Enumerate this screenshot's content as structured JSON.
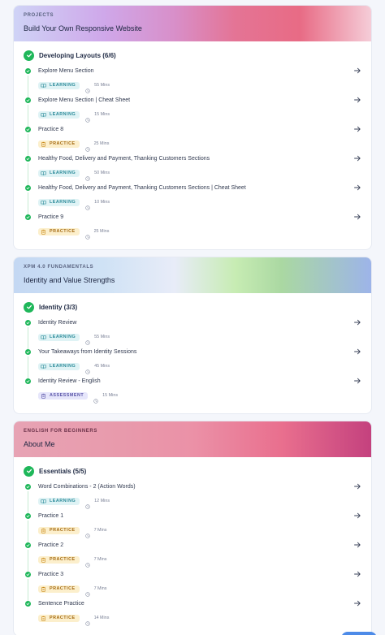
{
  "courses": [
    {
      "tag": "PROJECTS",
      "title": "Build Your Own Responsive Website",
      "module": "Developing Layouts (6/6)",
      "items": [
        {
          "title": "Explore Menu Section",
          "type": "LEARNING",
          "duration": "55 Mins"
        },
        {
          "title": "Explore Menu Section | Cheat Sheet",
          "type": "LEARNING",
          "duration": "15 Mins"
        },
        {
          "title": "Practice 8",
          "type": "PRACTICE",
          "duration": "25 Mins"
        },
        {
          "title": "Healthy Food, Delivery and Payment, Thanking Customers Sections",
          "type": "LEARNING",
          "duration": "50 Mins"
        },
        {
          "title": "Healthy Food, Delivery and Payment, Thanking Customers Sections | Cheat Sheet",
          "type": "LEARNING",
          "duration": "10 Mins"
        },
        {
          "title": "Practice 9",
          "type": "PRACTICE",
          "duration": "25 Mins"
        }
      ]
    },
    {
      "tag": "XPM 4.0 FUNDAMENTALS",
      "title": "Identity and Value Strengths",
      "module": "Identity (3/3)",
      "items": [
        {
          "title": "Identity Review",
          "type": "LEARNING",
          "duration": "55 Mins"
        },
        {
          "title": "Your Takeaways from Identity Sessions",
          "type": "LEARNING",
          "duration": "45 Mins"
        },
        {
          "title": "Identity Review - English",
          "type": "ASSESSMENT",
          "duration": "15 Mins"
        }
      ]
    },
    {
      "tag": "ENGLISH FOR BEGINNERS",
      "title": "About Me",
      "module": "Essentials (5/5)",
      "items": [
        {
          "title": "Word Combinations - 2 (Action Words)",
          "type": "LEARNING",
          "duration": "12 Mins"
        },
        {
          "title": "Practice 1",
          "type": "PRACTICE",
          "duration": "7 Mins"
        },
        {
          "title": "Practice 2",
          "type": "PRACTICE",
          "duration": "7 Mins"
        },
        {
          "title": "Practice 3",
          "type": "PRACTICE",
          "duration": "7 Mins"
        },
        {
          "title": "Sentence Practice",
          "type": "PRACTICE",
          "duration": "14 Mins"
        }
      ]
    }
  ],
  "colors": {
    "completed": "#1fb75a",
    "learning": "#2b8a99",
    "practice": "#a46a12",
    "assessment": "#5a55a8"
  }
}
